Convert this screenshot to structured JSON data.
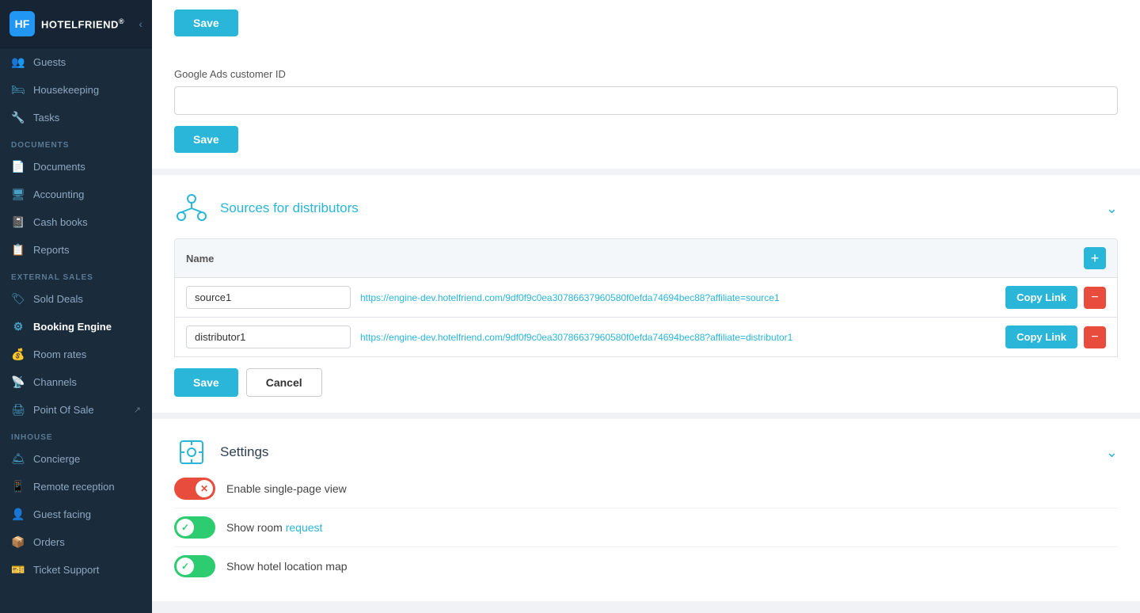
{
  "sidebar": {
    "logo": "HOTELFRIEND",
    "logo_reg": "®",
    "sections": [
      {
        "label": null,
        "items": [
          {
            "id": "guests",
            "icon": "👥",
            "label": "Guests"
          },
          {
            "id": "housekeeping",
            "icon": "🛏",
            "label": "Housekeeping"
          },
          {
            "id": "tasks",
            "icon": "🔧",
            "label": "Tasks"
          }
        ]
      },
      {
        "label": "DOCUMENTS",
        "items": [
          {
            "id": "documents",
            "icon": "📄",
            "label": "Documents"
          },
          {
            "id": "accounting",
            "icon": "🖥",
            "label": "Accounting"
          },
          {
            "id": "cash-books",
            "icon": "📓",
            "label": "Cash books"
          },
          {
            "id": "reports",
            "icon": "📋",
            "label": "Reports"
          }
        ]
      },
      {
        "label": "EXTERNAL SALES",
        "items": [
          {
            "id": "sold-deals",
            "icon": "🏷",
            "label": "Sold Deals"
          },
          {
            "id": "booking-engine",
            "icon": "⚙",
            "label": "Booking Engine",
            "active": true
          },
          {
            "id": "room-rates",
            "icon": "💰",
            "label": "Room rates"
          },
          {
            "id": "channels",
            "icon": "📡",
            "label": "Channels"
          },
          {
            "id": "point-of-sale",
            "icon": "🖨",
            "label": "Point Of Sale",
            "ext": true
          }
        ]
      },
      {
        "label": "INHOUSE",
        "items": [
          {
            "id": "concierge",
            "icon": "🛎",
            "label": "Concierge"
          },
          {
            "id": "remote-reception",
            "icon": "📱",
            "label": "Remote reception"
          },
          {
            "id": "guest-facing",
            "icon": "👤",
            "label": "Guest facing"
          },
          {
            "id": "orders",
            "icon": "📦",
            "label": "Orders"
          }
        ]
      },
      {
        "label": null,
        "items": [
          {
            "id": "ticket-support",
            "icon": "🎫",
            "label": "Ticket Support"
          }
        ]
      }
    ]
  },
  "main": {
    "google_ads": {
      "label": "Google Ads customer ID",
      "placeholder": "",
      "save_label": "Save"
    },
    "distributors_section": {
      "title_plain": "Sources for ",
      "title_highlight": "distributors",
      "table_header": "Name",
      "add_btn": "+",
      "rows": [
        {
          "name": "source1",
          "link": "https://engine-dev.hotelfriend.com/9df0f9c0ea30786637960580f0efda74694bec88?affiliate=source1",
          "copy_label": "Copy Link"
        },
        {
          "name": "distributor1",
          "link": "https://engine-dev.hotelfriend.com/9df0f9c0ea30786637960580f0efda74694bec88?affiliate=distributor1",
          "copy_label": "Copy Link"
        }
      ],
      "save_label": "Save",
      "cancel_label": "Cancel"
    },
    "settings_section": {
      "title": "Settings",
      "toggles": [
        {
          "label_plain": "Enable single-page view",
          "state": "off"
        },
        {
          "label_plain": "Show room ",
          "label_highlight": "request",
          "state": "on"
        },
        {
          "label_plain": "Show hotel location map",
          "state": "on"
        }
      ]
    }
  }
}
